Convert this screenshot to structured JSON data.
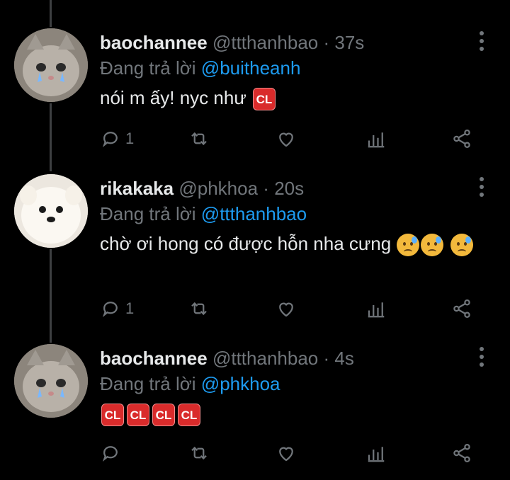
{
  "tweets": [
    {
      "name": "baochannee",
      "handle": "@ttthanhbao",
      "sep": "·",
      "time": "37s",
      "replying_prefix": "Đang trả lời",
      "replying_to": "@buitheanh",
      "text": "nói m ấy! nyc như",
      "cl_badges": [
        "CL"
      ],
      "reply_count": "1",
      "avatar": "cat-avatar"
    },
    {
      "name": "rikakaka",
      "handle": "@phkhoa",
      "sep": "·",
      "time": "20s",
      "replying_prefix": "Đang trả lời",
      "replying_to": "@ttthanhbao",
      "text": "chờ ơi hong có được hỗn nha cưng",
      "emoji": "sad-sweat-emoji",
      "reply_count": "1",
      "avatar": "dog-avatar"
    },
    {
      "name": "baochannee",
      "handle": "@ttthanhbao",
      "sep": "·",
      "time": "4s",
      "replying_prefix": "Đang trả lời",
      "replying_to": "@phkhoa",
      "text": "",
      "cl_badges": [
        "CL",
        "CL",
        "CL",
        "CL"
      ],
      "reply_count": "",
      "avatar": "cat-avatar"
    }
  ],
  "colors": {
    "background": "#000000",
    "text": "#e7e9ea",
    "muted": "#71767b",
    "link": "#1d9bf0",
    "cl_badge": "#d92b2b"
  }
}
